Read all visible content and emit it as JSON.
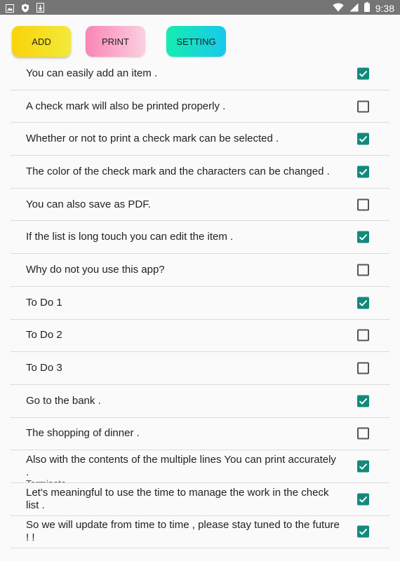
{
  "statusbar": {
    "time": "9:38"
  },
  "toolbar": {
    "add_label": "ADD",
    "print_label": "PRINT",
    "setting_label": "SETTING"
  },
  "items": [
    {
      "text": "You can easily add an item .",
      "checked": true
    },
    {
      "text": "A check mark will also be printed properly .",
      "checked": false
    },
    {
      "text": "Whether or not to print a check mark can be selected .",
      "checked": true
    },
    {
      "text": "The color of the check mark and the characters can be changed .",
      "checked": true
    },
    {
      "text": "You can also save as PDF.",
      "checked": false
    },
    {
      "text": "If the list is long touch you can edit the item .",
      "checked": true
    },
    {
      "text": "Why do not you use this app?",
      "checked": false
    },
    {
      "text": "To Do 1",
      "checked": true
    },
    {
      "text": "To Do 2",
      "checked": false
    },
    {
      "text": "To Do 3",
      "checked": false
    },
    {
      "text": "Go to the bank .",
      "checked": true
    },
    {
      "text": "The shopping of dinner .",
      "checked": false
    },
    {
      "text": "Also with the contents of the multiple lines You can print accurately .",
      "overflow_text": "Terminate",
      "checked": true
    },
    {
      "text": "Let's meaningful to use the time to manage the work in the check list .",
      "checked": true
    },
    {
      "text": "So we will update from time to time , please stay tuned to the future ! !",
      "checked": true
    }
  ]
}
